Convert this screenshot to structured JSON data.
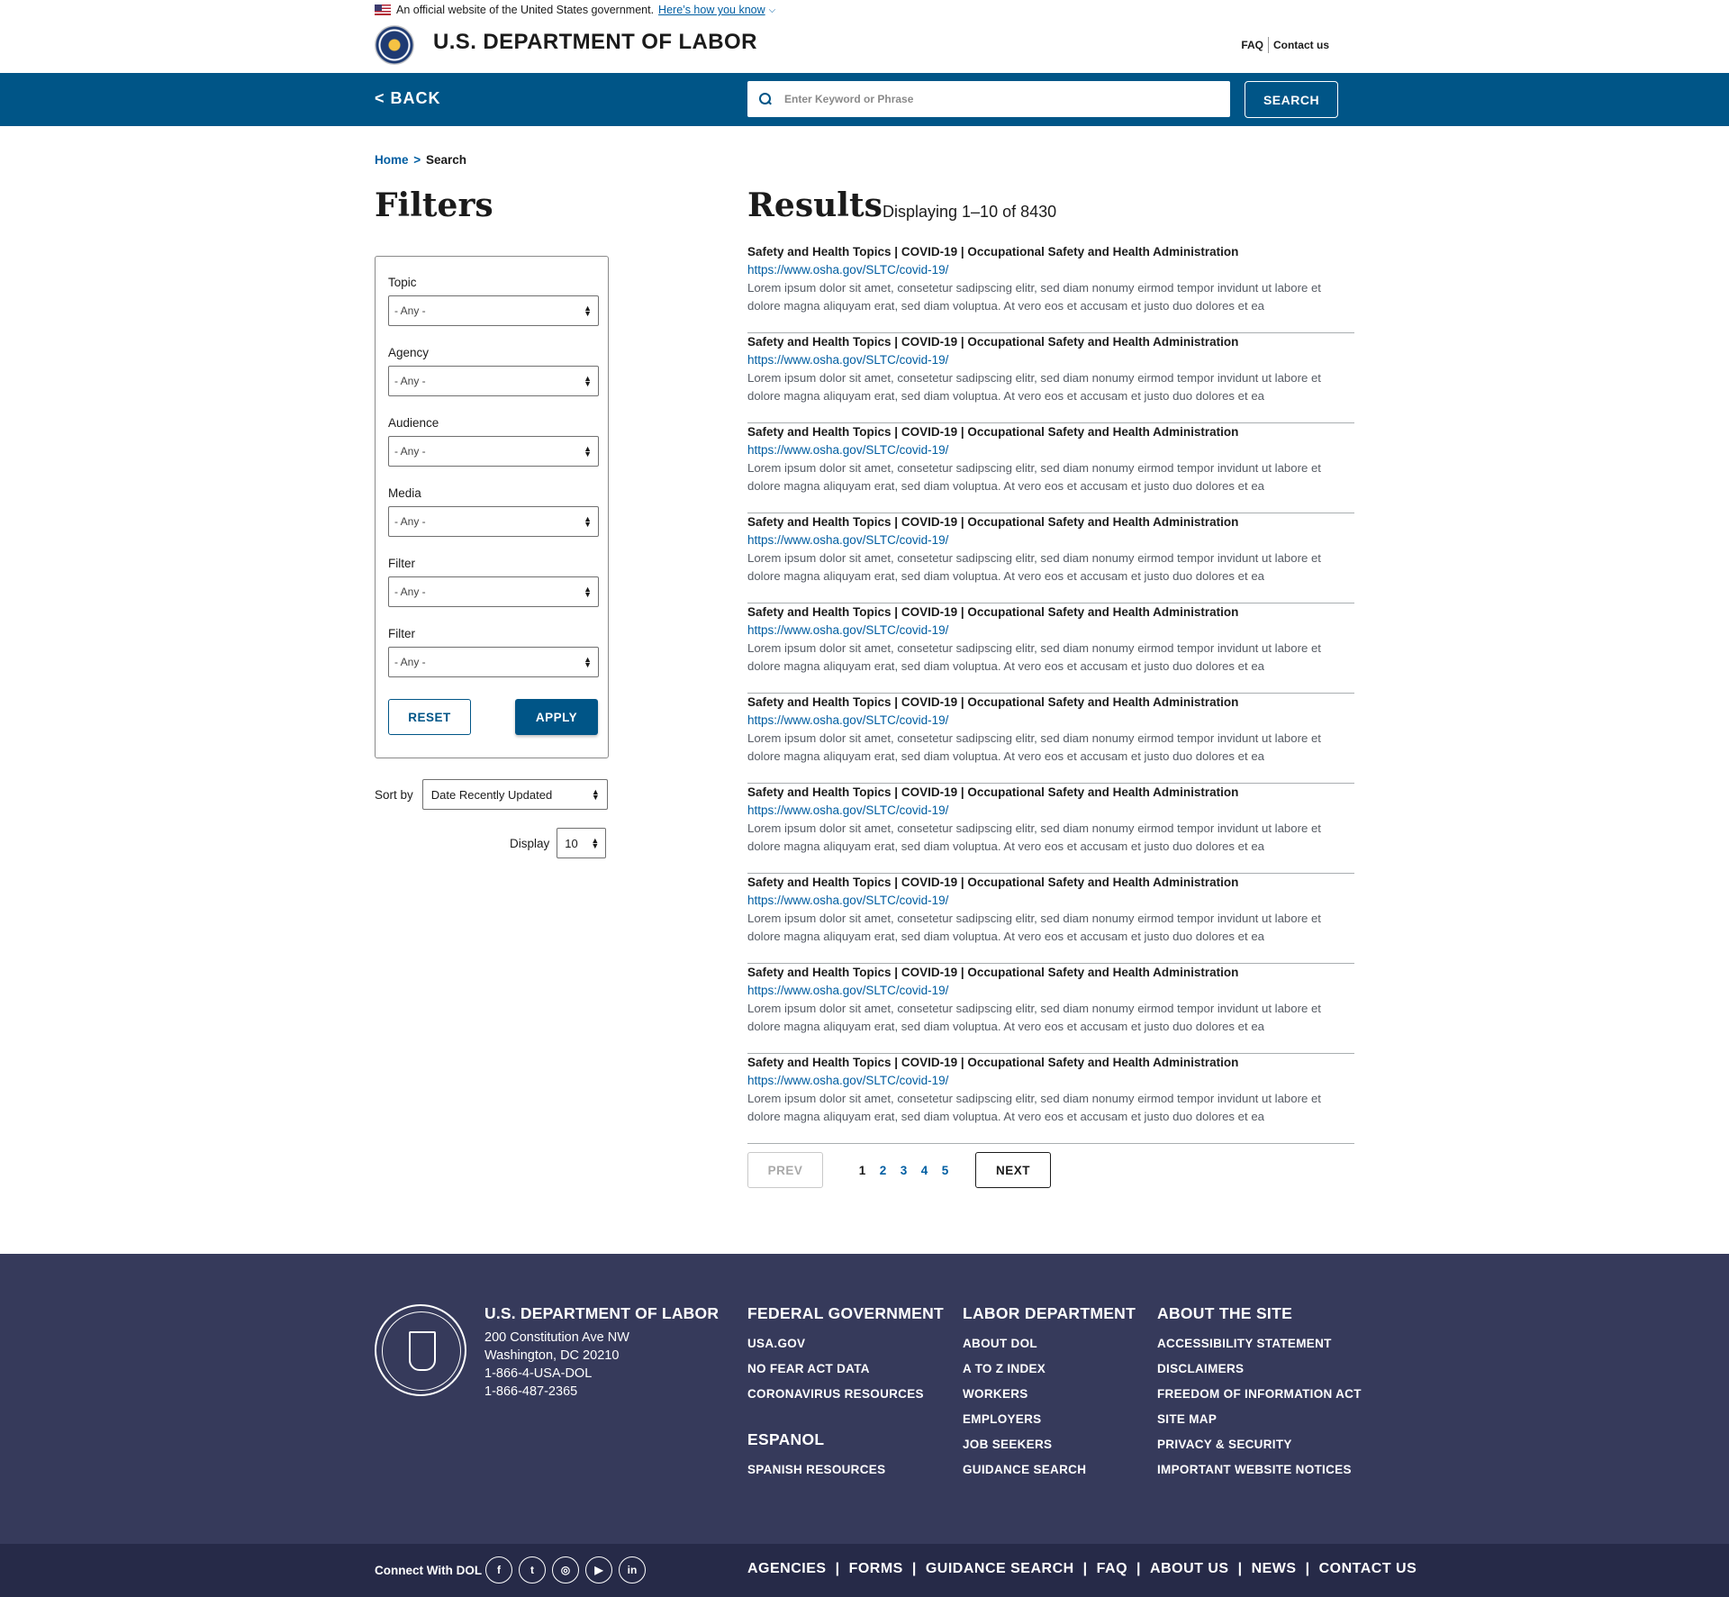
{
  "gov_banner": {
    "text": "An official website of the United States government.",
    "link": "Here’s how you know"
  },
  "header": {
    "title": "U.S. DEPARTMENT OF LABOR",
    "utility_nav": [
      "FAQ",
      "Contact us"
    ]
  },
  "searchbar": {
    "back_label": "< BACK",
    "placeholder": "Enter Keyword or Phrase",
    "button_label": "SEARCH"
  },
  "breadcrumb": {
    "home": "Home",
    "separator": ">",
    "current": "Search"
  },
  "filters": {
    "heading": "Filters",
    "groups": [
      {
        "label": "Topic",
        "value": "- Any -"
      },
      {
        "label": "Agency",
        "value": "- Any -"
      },
      {
        "label": "Audience",
        "value": "- Any -"
      },
      {
        "label": "Media",
        "value": "- Any -"
      },
      {
        "label": "Filter",
        "value": "- Any -"
      },
      {
        "label": "Filter",
        "value": "- Any -"
      }
    ],
    "reset_label": "RESET",
    "apply_label": "APPLY",
    "sort_label": "Sort by",
    "sort_value": "Date Recently Updated",
    "display_label": "Display",
    "display_value": "10"
  },
  "results": {
    "heading": "Results",
    "count_text": "Displaying 1–10 of 8430",
    "items": [
      {
        "title": "Safety and Health Topics | COVID-19 | Occupational Safety and Health Administration",
        "url": "https://www.osha.gov/SLTC/covid-19/",
        "desc": "Lorem ipsum dolor sit amet, consetetur sadipscing elitr, sed diam nonumy eirmod tempor invidunt ut labore et dolore magna aliquyam erat, sed diam voluptua. At vero eos et accusam et justo duo dolores et ea"
      },
      {
        "title": "Safety and Health Topics | COVID-19 | Occupational Safety and Health Administration",
        "url": "https://www.osha.gov/SLTC/covid-19/",
        "desc": "Lorem ipsum dolor sit amet, consetetur sadipscing elitr, sed diam nonumy eirmod tempor invidunt ut labore et dolore magna aliquyam erat, sed diam voluptua. At vero eos et accusam et justo duo dolores et ea"
      },
      {
        "title": "Safety and Health Topics | COVID-19 | Occupational Safety and Health Administration",
        "url": "https://www.osha.gov/SLTC/covid-19/",
        "desc": "Lorem ipsum dolor sit amet, consetetur sadipscing elitr, sed diam nonumy eirmod tempor invidunt ut labore et dolore magna aliquyam erat, sed diam voluptua. At vero eos et accusam et justo duo dolores et ea"
      },
      {
        "title": "Safety and Health Topics | COVID-19 | Occupational Safety and Health Administration",
        "url": "https://www.osha.gov/SLTC/covid-19/",
        "desc": "Lorem ipsum dolor sit amet, consetetur sadipscing elitr, sed diam nonumy eirmod tempor invidunt ut labore et dolore magna aliquyam erat, sed diam voluptua. At vero eos et accusam et justo duo dolores et ea"
      },
      {
        "title": "Safety and Health Topics | COVID-19 | Occupational Safety and Health Administration",
        "url": "https://www.osha.gov/SLTC/covid-19/",
        "desc": "Lorem ipsum dolor sit amet, consetetur sadipscing elitr, sed diam nonumy eirmod tempor invidunt ut labore et dolore magna aliquyam erat, sed diam voluptua. At vero eos et accusam et justo duo dolores et ea"
      },
      {
        "title": "Safety and Health Topics | COVID-19 | Occupational Safety and Health Administration",
        "url": "https://www.osha.gov/SLTC/covid-19/",
        "desc": "Lorem ipsum dolor sit amet, consetetur sadipscing elitr, sed diam nonumy eirmod tempor invidunt ut labore et dolore magna aliquyam erat, sed diam voluptua. At vero eos et accusam et justo duo dolores et ea"
      },
      {
        "title": "Safety and Health Topics | COVID-19 | Occupational Safety and Health Administration",
        "url": "https://www.osha.gov/SLTC/covid-19/",
        "desc": "Lorem ipsum dolor sit amet, consetetur sadipscing elitr, sed diam nonumy eirmod tempor invidunt ut labore et dolore magna aliquyam erat, sed diam voluptua. At vero eos et accusam et justo duo dolores et ea"
      },
      {
        "title": "Safety and Health Topics | COVID-19 | Occupational Safety and Health Administration",
        "url": "https://www.osha.gov/SLTC/covid-19/",
        "desc": "Lorem ipsum dolor sit amet, consetetur sadipscing elitr, sed diam nonumy eirmod tempor invidunt ut labore et dolore magna aliquyam erat, sed diam voluptua. At vero eos et accusam et justo duo dolores et ea"
      },
      {
        "title": "Safety and Health Topics | COVID-19 | Occupational Safety and Health Administration",
        "url": "https://www.osha.gov/SLTC/covid-19/",
        "desc": "Lorem ipsum dolor sit amet, consetetur sadipscing elitr, sed diam nonumy eirmod tempor invidunt ut labore et dolore magna aliquyam erat, sed diam voluptua. At vero eos et accusam et justo duo dolores et ea"
      },
      {
        "title": "Safety and Health Topics | COVID-19 | Occupational Safety and Health Administration",
        "url": "https://www.osha.gov/SLTC/covid-19/",
        "desc": "Lorem ipsum dolor sit amet, consetetur sadipscing elitr, sed diam nonumy eirmod tempor invidunt ut labore et dolore magna aliquyam erat, sed diam voluptua. At vero eos et accusam et justo duo dolores et ea"
      }
    ]
  },
  "pagination": {
    "prev_label": "PREV",
    "next_label": "NEXT",
    "pages": [
      "1",
      "2",
      "3",
      "4",
      "5"
    ],
    "current_page": "1"
  },
  "footer": {
    "org_name": "U.S. DEPARTMENT OF LABOR",
    "address_lines": [
      "200 Constitution Ave NW",
      "Washington, DC 20210",
      "1-866-4-USA-DOL",
      "1-866-487-2365"
    ],
    "columns": {
      "federal": {
        "title": "FEDERAL GOVERNMENT",
        "links": [
          "USA.GOV",
          "NO FEAR ACT DATA",
          "CORONAVIRUS RESOURCES"
        ]
      },
      "espanol": {
        "title": "ESPANOL",
        "links": [
          "SPANISH RESOURCES"
        ]
      },
      "labor": {
        "title": "LABOR DEPARTMENT",
        "links": [
          "ABOUT DOL",
          "A TO Z INDEX",
          "WORKERS",
          "EMPLOYERS",
          "JOB SEEKERS",
          "GUIDANCE SEARCH"
        ]
      },
      "about": {
        "title": "ABOUT THE SITE",
        "links": [
          "ACCESSIBILITY STATEMENT",
          "DISCLAIMERS",
          "FREEDOM OF INFORMATION ACT",
          "SITE MAP",
          "PRIVACY & SECURITY",
          "IMPORTANT WEBSITE NOTICES"
        ]
      }
    }
  },
  "subfooter": {
    "connect_label": "Connect With DOL",
    "social": [
      {
        "name": "facebook-icon",
        "glyph": "f"
      },
      {
        "name": "twitter-icon",
        "glyph": "t"
      },
      {
        "name": "instagram-icon",
        "glyph": "◎"
      },
      {
        "name": "youtube-icon",
        "glyph": "▶"
      },
      {
        "name": "linkedin-icon",
        "glyph": "in"
      }
    ],
    "nav": [
      "AGENCIES",
      "FORMS",
      "GUIDANCE SEARCH",
      "FAQ",
      "ABOUT US",
      "NEWS",
      "CONTACT US"
    ]
  },
  "colors": {
    "brand_blue": "#005587",
    "link_blue": "#005ea2",
    "footer_bg": "#363a5b",
    "subfooter_bg": "#262a48"
  }
}
